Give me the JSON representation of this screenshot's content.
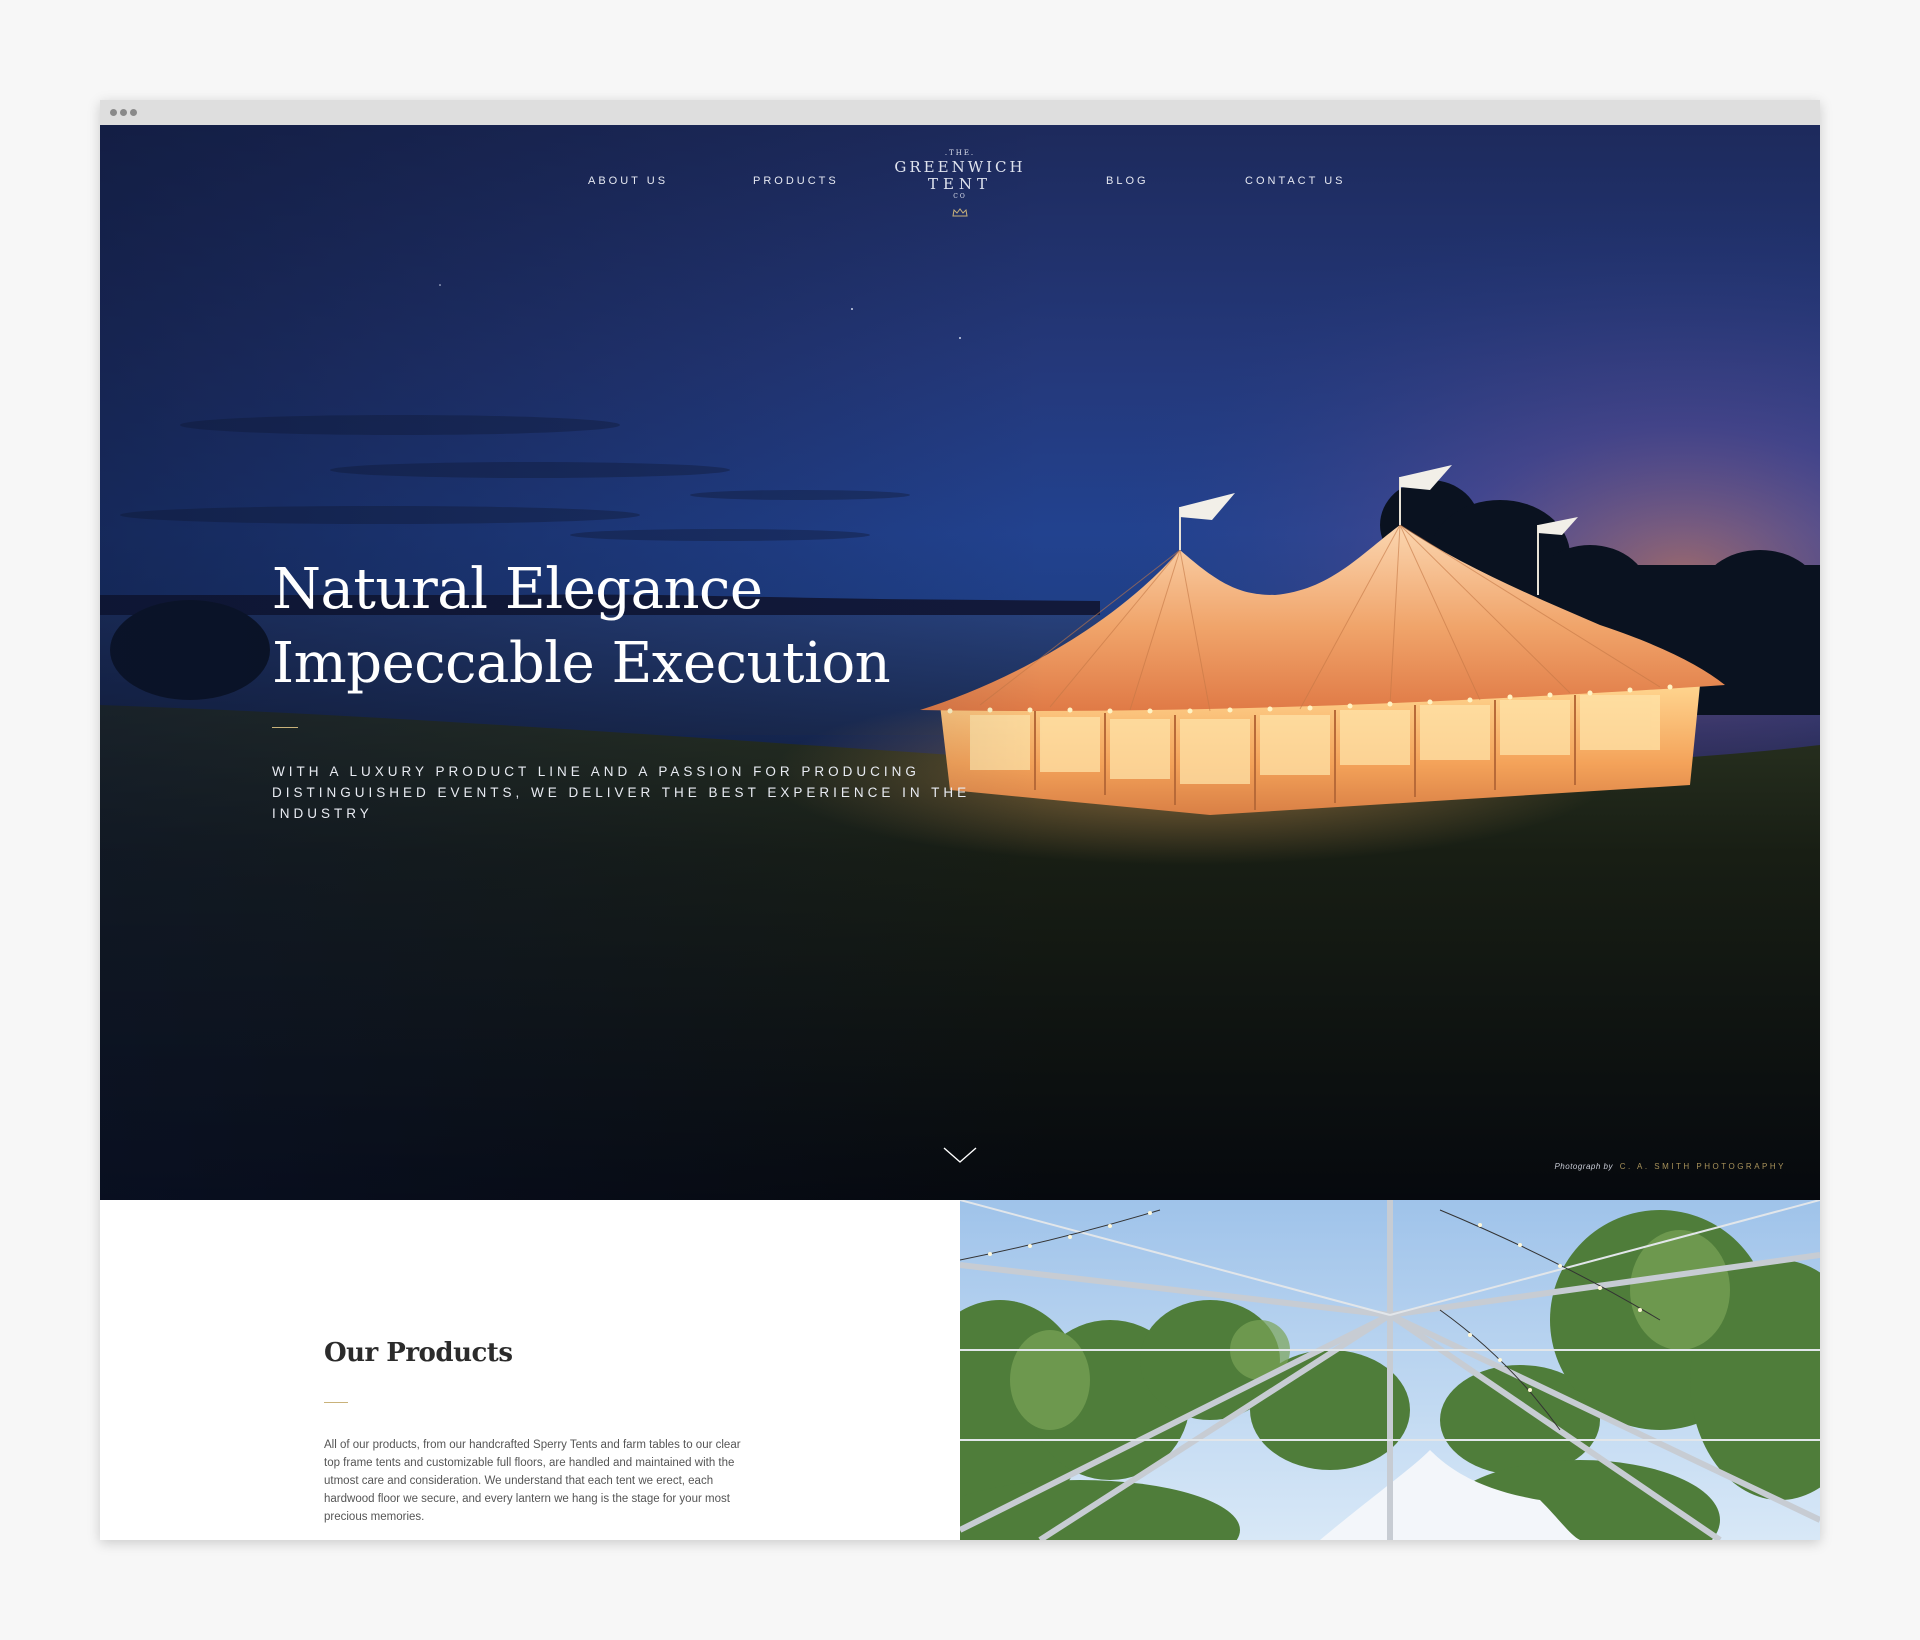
{
  "nav": {
    "about": "ABOUT US",
    "products": "PRODUCTS",
    "blog": "BLOG",
    "contact": "CONTACT US"
  },
  "logo": {
    "the": ".THE.",
    "line1": "GREENWICH",
    "line2": "TENT",
    "co": "CO"
  },
  "hero": {
    "headline_line1": "Natural Elegance",
    "headline_line2": "Impeccable Execution",
    "tagline": "With a luxury product line and a passion for producing distinguished events, we deliver the best experience in the industry",
    "credit_prefix": "Photograph by",
    "credit_name": "C. A. SMITH PHOTOGRAPHY"
  },
  "products": {
    "title": "Our Products",
    "body": "All of our products, from our handcrafted Sperry Tents and farm tables to our clear top frame tents and customizable full floors, are handled and maintained with the utmost care and consideration. We understand that each tent we erect, each hardwood floor we secure, and every lantern we hang is the stage for your most precious memories."
  },
  "colors": {
    "accent_gold": "#c9b27a",
    "hero_navy": "#1f3f86",
    "text_dark": "#2b2b2b"
  },
  "icons": {
    "scroll": "chevron-down-icon",
    "logo_mark": "crown-icon",
    "window_controls": "window-dots-icon"
  }
}
